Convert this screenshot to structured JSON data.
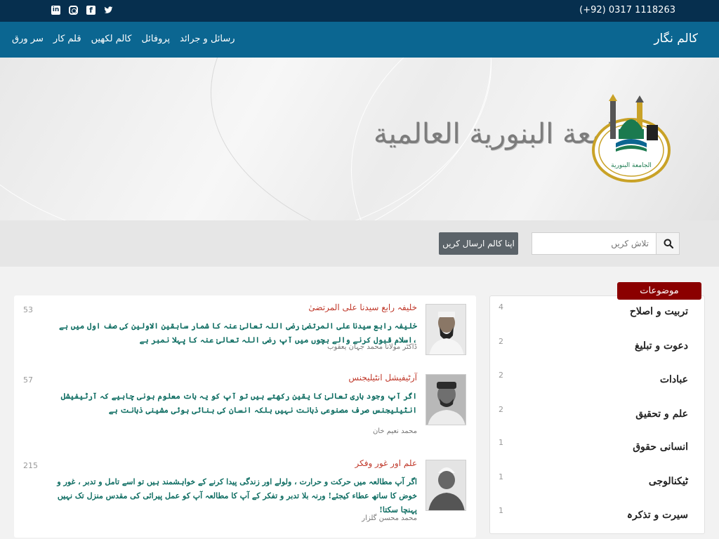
{
  "topbar": {
    "social": [
      "linkedin-icon",
      "instagram-icon",
      "facebook-icon",
      "twitter-icon"
    ],
    "phone": "(+92) 0317 1118263"
  },
  "nav": {
    "brand": "کالم نگار",
    "items": [
      "سر ورق",
      "قلم کار",
      "کالم لکھیں",
      "پروفائل",
      "رسائل و جرائد"
    ]
  },
  "banner": {
    "calligraphy": "الجامعة البنورية العالمية"
  },
  "search": {
    "placeholder": "تلاش کریں",
    "submit_label": "اپنا کالم ارسال کریں"
  },
  "articles": [
    {
      "title": "خلیفہ رابع سیدنا علی المرتضیٰ",
      "excerpt": "خلیفہ رابع سیدنا علی المرتضیٰ رضی اللہ تعالیٰ عنہ کا شمار سابقین الاولین کی صف اول میں ہے ،اسلام قبول کرنے والے بچوں میں آپ رضی اللہ تعالیٰ عنہ کا پہلا نمبر ہے",
      "author": "ڈاکٹر مولانا محمد جہان یعقوب",
      "count": "53"
    },
    {
      "title": "آرٹیفیشل انٹیلیجنس",
      "excerpt": "اگر آپ وجود باری تعالیٰ کا یقین رکھتے ہیں تو آپ کو یہ بات معلوم ہونی چاہیے کہ آرٹیفیشل انٹیلیجنس صرف مصنوعی ذہانت نہیں بلکہ انسان کی بنائی ہوئی مشینی ذہانت ہے",
      "author": "محمد نعیم خان",
      "count": "57"
    },
    {
      "title": "علم اور غور وفکر",
      "excerpt": "اگر آپ مطالعہ میں حرکت و حرارت ، ولولے اور زندگی پیدا کرنے کے خواہشمند ہیں تو اسے تامل و تدبر ، غور و خوض کا ساتھ عطاء کیجئے! ورنہ بلا تدبر و تفکر کے آپ کا مطالعہ آپ کو عمل پیرائی کی مقدس منزل تک نہیں پہنچا سکتا!",
      "author": "محمد محسن گلزار",
      "count": "215"
    }
  ],
  "topics": {
    "header": "موضوعات",
    "items": [
      {
        "label": "تربیت و اصلاح",
        "count": "4"
      },
      {
        "label": "دعوت و تبلیغ",
        "count": "2"
      },
      {
        "label": "عبادات",
        "count": "2"
      },
      {
        "label": "علم و تحقیق",
        "count": "2"
      },
      {
        "label": "انسانی حقوق",
        "count": "1"
      },
      {
        "label": "ٹیکنالوجی",
        "count": "1"
      },
      {
        "label": "سیرت و تذکرہ",
        "count": "1"
      }
    ]
  },
  "colors": {
    "topbar": "#062f4e",
    "navbar": "#0b6691",
    "article_title": "#c0392b",
    "excerpt": "#0e6d62",
    "topics_header": "#8b0000"
  }
}
